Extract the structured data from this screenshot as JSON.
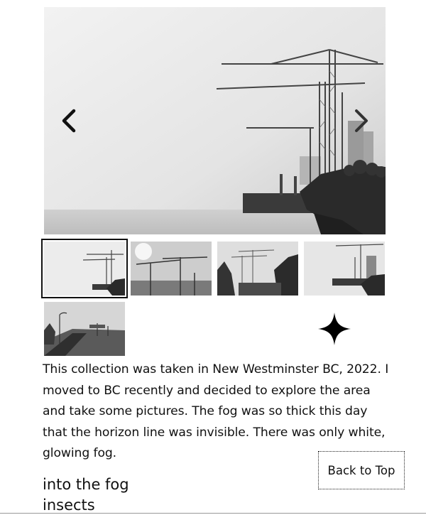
{
  "gallery": {
    "main_image": "fog-cranes-waterfront-photo",
    "prev_icon": "chevron-left-icon",
    "next_icon": "chevron-right-icon",
    "thumbnails": [
      {
        "name": "thumb-cranes-waterfront",
        "active": true
      },
      {
        "name": "thumb-sun-cranes",
        "active": false
      },
      {
        "name": "thumb-trees-cranes",
        "active": false
      },
      {
        "name": "thumb-crane-pier",
        "active": false
      },
      {
        "name": "thumb-foggy-highway",
        "active": false
      }
    ]
  },
  "decoration": {
    "icon": "sparkle-icon"
  },
  "description": {
    "text": "This collection was taken in New Westminster BC, 2022. I moved to BC recently and decided to explore the area and take some pictures. The fog was so thick this day that the horizon line was invisible. There was only white, glowing fog."
  },
  "actions": {
    "back_to_top": "Back to Top"
  },
  "links": {
    "link1": "into the fog",
    "link2": "insects"
  }
}
